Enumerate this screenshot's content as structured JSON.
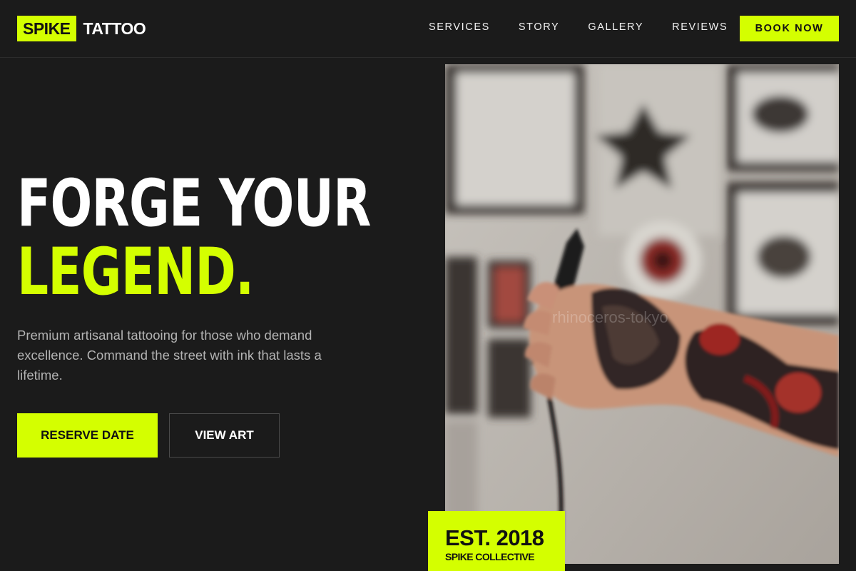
{
  "brand": {
    "badge": "SPIKE",
    "name": "TATTOO"
  },
  "nav": {
    "items": [
      {
        "label": "SERVICES"
      },
      {
        "label": "STORY"
      },
      {
        "label": "GALLERY"
      },
      {
        "label": "REVIEWS"
      }
    ],
    "cta": "BOOK NOW"
  },
  "hero": {
    "title_line1": "FORGE YOUR",
    "title_line2": "LEGEND.",
    "description": "Premium artisanal tattooing for those who demand excellence. Command the street with ink that lasts a lifetime.",
    "primary_button": "RESERVE DATE",
    "secondary_button": "VIEW ART"
  },
  "photo": {
    "subject": "tattoo-artist-hand-holding-tattoo-machine",
    "watermark": "rhinoceros-tokyo"
  },
  "badge": {
    "year": "EST. 2018",
    "subtitle": "SPIKE COLLECTIVE"
  },
  "colors": {
    "accent": "#d4ff00",
    "background": "#1b1b1b",
    "text": "#ffffff",
    "muted_text": "#b3b3b3"
  }
}
